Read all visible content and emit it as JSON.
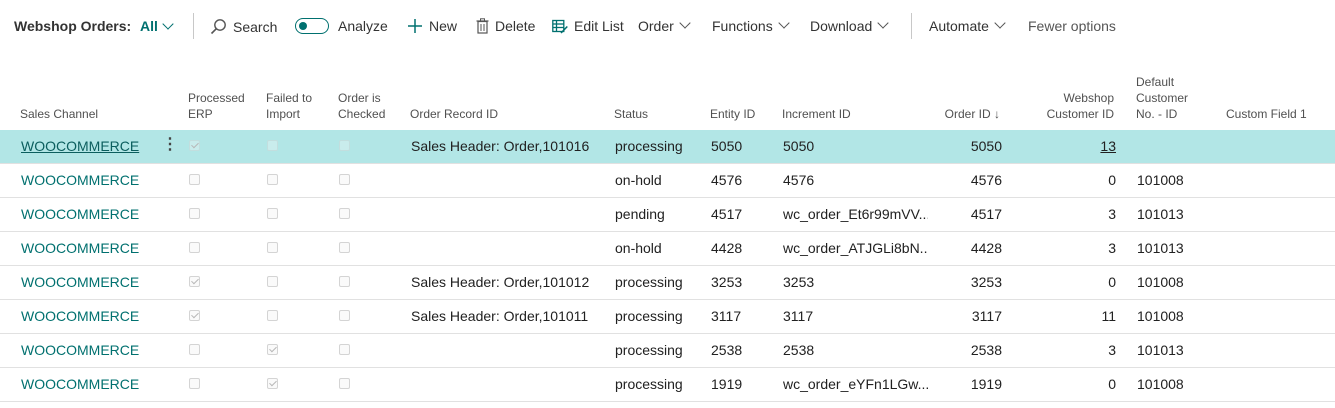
{
  "toolbar": {
    "title": "Webshop Orders:",
    "filter": "All",
    "search": "Search",
    "analyze": "Analyze",
    "new": "New",
    "delete": "Delete",
    "edit_list": "Edit List",
    "order": "Order",
    "functions": "Functions",
    "download": "Download",
    "automate": "Automate",
    "fewer_options": "Fewer options"
  },
  "grid": {
    "headers": {
      "sales_channel": "Sales Channel",
      "processed_erp_1": "Processed",
      "processed_erp_2": "ERP",
      "failed_import_1": "Failed to",
      "failed_import_2": "Import",
      "order_checked_1": "Order is",
      "order_checked_2": "Checked",
      "order_record_id": "Order Record ID",
      "status": "Status",
      "entity_id": "Entity ID",
      "increment_id": "Increment ID",
      "order_id": "Order ID",
      "sort_arrow": "↓",
      "webshop_customer_id_1": "Webshop",
      "webshop_customer_id_2": "Customer ID",
      "default_customer_1": "Default",
      "default_customer_2": "Customer",
      "default_customer_3": "No. - ID",
      "custom_field_1": "Custom Field 1"
    },
    "rows": [
      {
        "sales_channel": "WOOCOMMERCE",
        "processed_erp": true,
        "failed_import": false,
        "order_checked": false,
        "order_record_id": "Sales Header: Order,101016",
        "status": "processing",
        "entity_id": "5050",
        "increment_id": "5050",
        "order_id": "5050",
        "webshop_customer_id": "13",
        "default_customer": "",
        "custom_field_1": ""
      },
      {
        "sales_channel": "WOOCOMMERCE",
        "processed_erp": false,
        "failed_import": false,
        "order_checked": false,
        "order_record_id": "",
        "status": "on-hold",
        "entity_id": "4576",
        "increment_id": "4576",
        "order_id": "4576",
        "webshop_customer_id": "0",
        "default_customer": "101008",
        "custom_field_1": ""
      },
      {
        "sales_channel": "WOOCOMMERCE",
        "processed_erp": false,
        "failed_import": false,
        "order_checked": false,
        "order_record_id": "",
        "status": "pending",
        "entity_id": "4517",
        "increment_id": "wc_order_Et6r99mVV...",
        "order_id": "4517",
        "webshop_customer_id": "3",
        "default_customer": "101013",
        "custom_field_1": ""
      },
      {
        "sales_channel": "WOOCOMMERCE",
        "processed_erp": false,
        "failed_import": false,
        "order_checked": false,
        "order_record_id": "",
        "status": "on-hold",
        "entity_id": "4428",
        "increment_id": "wc_order_ATJGLi8bN...",
        "order_id": "4428",
        "webshop_customer_id": "3",
        "default_customer": "101013",
        "custom_field_1": ""
      },
      {
        "sales_channel": "WOOCOMMERCE",
        "processed_erp": true,
        "failed_import": false,
        "order_checked": false,
        "order_record_id": "Sales Header: Order,101012",
        "status": "processing",
        "entity_id": "3253",
        "increment_id": "3253",
        "order_id": "3253",
        "webshop_customer_id": "0",
        "default_customer": "101008",
        "custom_field_1": ""
      },
      {
        "sales_channel": "WOOCOMMERCE",
        "processed_erp": true,
        "failed_import": false,
        "order_checked": false,
        "order_record_id": "Sales Header: Order,101011",
        "status": "processing",
        "entity_id": "3117",
        "increment_id": "3117",
        "order_id": "3117",
        "webshop_customer_id": "11",
        "default_customer": "101008",
        "custom_field_1": ""
      },
      {
        "sales_channel": "WOOCOMMERCE",
        "processed_erp": false,
        "failed_import": true,
        "order_checked": false,
        "order_record_id": "",
        "status": "processing",
        "entity_id": "2538",
        "increment_id": "2538",
        "order_id": "2538",
        "webshop_customer_id": "3",
        "default_customer": "101013",
        "custom_field_1": ""
      },
      {
        "sales_channel": "WOOCOMMERCE",
        "processed_erp": false,
        "failed_import": true,
        "order_checked": false,
        "order_record_id": "",
        "status": "processing",
        "entity_id": "1919",
        "increment_id": "wc_order_eYFn1LGw...",
        "order_id": "1919",
        "webshop_customer_id": "0",
        "default_customer": "101008",
        "custom_field_1": ""
      }
    ]
  },
  "colors": {
    "accent": "#00706f",
    "selected_row": "#b2e6e6"
  }
}
